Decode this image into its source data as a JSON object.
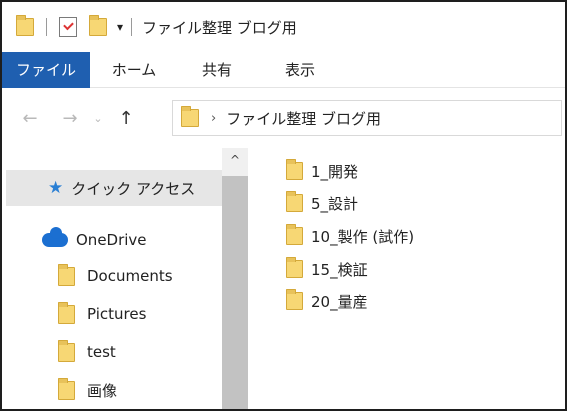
{
  "window": {
    "title": "ファイル整理 ブログ用",
    "qa_dropdown_glyph": "▾"
  },
  "ribbon": {
    "tabs": [
      "ファイル",
      "ホーム",
      "共有",
      "表示"
    ]
  },
  "navigation": {
    "back_glyph": "←",
    "forward_glyph": "→",
    "recent_glyph": "⌄",
    "up_glyph": "↑",
    "address_chevron": "›",
    "address_path": "ファイル整理 ブログ用"
  },
  "nav_pane": {
    "quick_access": "クイック アクセス",
    "onedrive": "OneDrive",
    "onedrive_items": [
      "Documents",
      "Pictures",
      "test",
      "画像"
    ],
    "scroll_up_glyph": "^"
  },
  "folders": [
    "1_開発",
    "5_設計",
    "10_製作 (試作)",
    "15_検証",
    "20_量産"
  ],
  "colors": {
    "ribbon_file_tab": "#1f5fb0",
    "folder_fill": "#f7d774",
    "selected_nav_bg": "#e6e6e6",
    "onedrive_blue": "#1b6fd1",
    "quick_access_star": "#2a7fd4"
  }
}
